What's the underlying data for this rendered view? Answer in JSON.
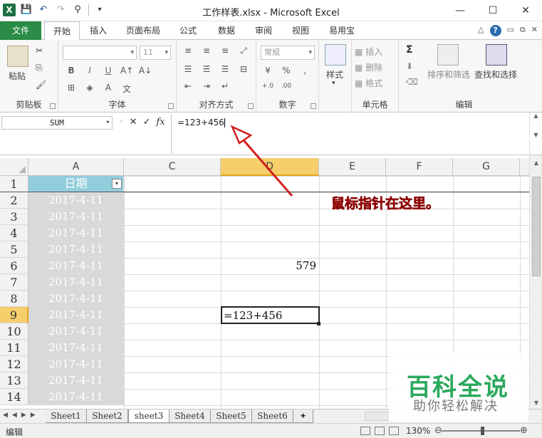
{
  "window": {
    "title": "工作样表.xlsx - Microsoft Excel",
    "app_icon": "X",
    "controls": [
      "—",
      "☐",
      "✕"
    ]
  },
  "ribbon_tabs": [
    {
      "label": "文件",
      "active": false,
      "file": true
    },
    {
      "label": "开始",
      "active": true
    },
    {
      "label": "插入",
      "active": false
    },
    {
      "label": "页面布局",
      "active": false
    },
    {
      "label": "公式",
      "active": false
    },
    {
      "label": "数据",
      "active": false
    },
    {
      "label": "审阅",
      "active": false
    },
    {
      "label": "视图",
      "active": false
    },
    {
      "label": "易用宝",
      "active": false
    }
  ],
  "ribbon": {
    "clipboard": {
      "label": "剪贴板",
      "paste": "粘贴"
    },
    "font": {
      "label": "字体",
      "font_size": "11",
      "bold": "B",
      "italic": "I",
      "underline": "U"
    },
    "alignment": {
      "label": "对齐方式"
    },
    "number": {
      "label": "数字",
      "format": "常规",
      "percent": "%"
    },
    "styles": {
      "label": "样式",
      "button": "样式"
    },
    "cells": {
      "label": "单元格",
      "insert": "插入",
      "delete": "删除",
      "format": "格式"
    },
    "editing": {
      "label": "编辑",
      "sum": "Σ",
      "sort_filter": "排序和筛选",
      "find_select": "查找和选择"
    }
  },
  "formula_bar": {
    "name_box": "SUM",
    "fx": "fx",
    "cancel": "✕",
    "enter": "✓",
    "content": "=123+456"
  },
  "columns": [
    "A",
    "C",
    "D",
    "E",
    "F",
    "G"
  ],
  "selected_column": "D",
  "selected_row": "9",
  "rows": [
    {
      "num": "1",
      "a": "日期",
      "d": ""
    },
    {
      "num": "2",
      "a": "2017-4-11",
      "d": ""
    },
    {
      "num": "3",
      "a": "2017-4-11",
      "d": ""
    },
    {
      "num": "4",
      "a": "2017-4-11",
      "d": ""
    },
    {
      "num": "5",
      "a": "2017-4-11",
      "d": ""
    },
    {
      "num": "6",
      "a": "2017-4-11",
      "d": "579"
    },
    {
      "num": "7",
      "a": "2017-4-11",
      "d": ""
    },
    {
      "num": "8",
      "a": "2017-4-11",
      "d": ""
    },
    {
      "num": "9",
      "a": "2017-4-11",
      "d": "=123+456"
    },
    {
      "num": "10",
      "a": "2017-4-11",
      "d": ""
    },
    {
      "num": "11",
      "a": "2017-4-11",
      "d": ""
    },
    {
      "num": "12",
      "a": "2017-4-11",
      "d": ""
    },
    {
      "num": "13",
      "a": "2017-4-11",
      "d": ""
    },
    {
      "num": "14",
      "a": "2017-4-11",
      "d": ""
    }
  ],
  "annotation": "鼠标指针在这里。",
  "sheet_tabs": [
    "Sheet1",
    "Sheet2",
    "sheet3",
    "Sheet4",
    "Sheet5",
    "Sheet6"
  ],
  "active_sheet": "sheet3",
  "status": {
    "mode": "编辑",
    "zoom": "130%"
  },
  "watermark": {
    "title": "百科全说",
    "subtitle": "助你轻松解决"
  },
  "colors": {
    "file_tab": "#2a8c46",
    "header_cell": "#92cddc",
    "date_cell": "#d9d9d9",
    "selected_header": "#f6cf6b",
    "annotation": "#e02020"
  }
}
